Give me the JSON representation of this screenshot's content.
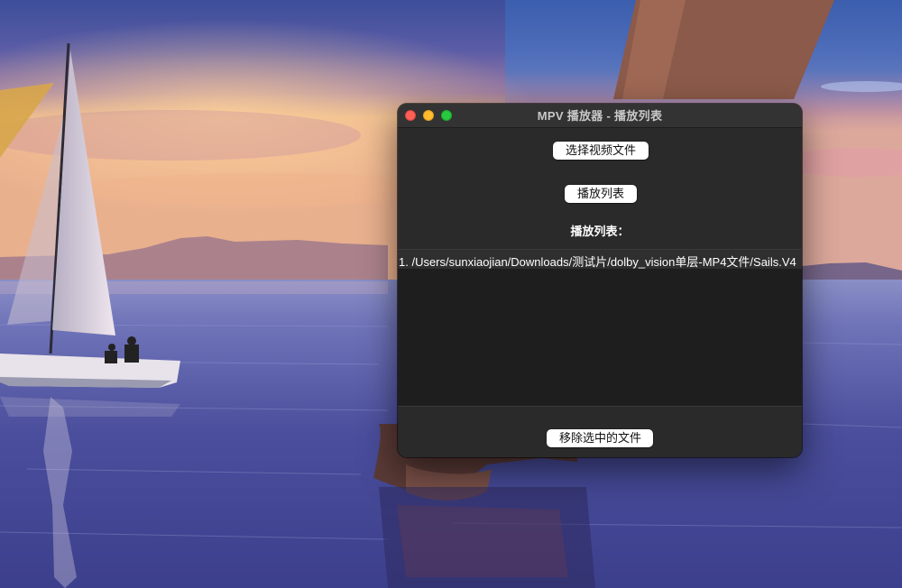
{
  "window": {
    "title": "MPV 播放器 - 播放列表"
  },
  "buttons": {
    "select_video": "选择视频文件",
    "playlist": "播放列表",
    "remove_selected": "移除选中的文件"
  },
  "playlist": {
    "label": "播放列表：",
    "items": [
      "1. /Users/sunxiaojian/Downloads/测试片/dolby_vision单层-MP4文件/Sails.V4"
    ]
  },
  "colors": {
    "window_bg": "#2a2a2a",
    "list_bg": "#1e1e1e",
    "close": "#fe5f57",
    "minimize": "#febc2e",
    "maximize": "#28c840"
  },
  "icons": [
    "close-icon",
    "minimize-icon",
    "maximize-icon"
  ]
}
